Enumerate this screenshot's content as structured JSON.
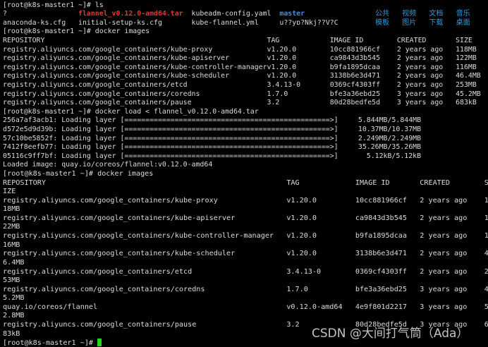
{
  "colors": {
    "background": "#000000",
    "text": "#dcdcdc",
    "archive": "#e8352f",
    "directory": "#3c8ff0",
    "cjk_dir": "#2f9ad8",
    "cursor": "#21d821"
  },
  "ls": {
    "prompt": "[root@k8s-master1 ~]# ls",
    "rows": [
      [
        {
          "t": "?"
        },
        {
          "t": "flannel_v0.12.0-amd64.tar",
          "k": "red"
        },
        {
          "t": "kubeadm-config.yaml"
        },
        {
          "t": "master",
          "k": "blue"
        },
        {
          "t": "公共",
          "k": "cjk"
        },
        {
          "t": "视频",
          "k": "cjk"
        },
        {
          "t": "文档",
          "k": "cjk"
        },
        {
          "t": "音乐",
          "k": "cjk"
        }
      ],
      [
        {
          "t": "anaconda-ks.cfg"
        },
        {
          "t": "initial-setup-ks.cfg"
        },
        {
          "t": "kube-flannel.yml"
        },
        {
          "t": "u??yɒ?Nkj??V?C"
        },
        {
          "t": "模板",
          "k": "cjk"
        },
        {
          "t": "图片",
          "k": "cjk"
        },
        {
          "t": "下载",
          "k": "cjk"
        },
        {
          "t": "桌面",
          "k": "cjk"
        }
      ]
    ]
  },
  "images1": {
    "prompt": "[root@k8s-master1 ~]# docker images",
    "header": [
      "REPOSITORY",
      "TAG",
      "IMAGE ID",
      "CREATED",
      "SIZE"
    ],
    "rows": [
      [
        "registry.aliyuncs.com/google_containers/kube-proxy",
        "v1.20.0",
        "10cc881966cf",
        "2 years ago",
        "118MB"
      ],
      [
        "registry.aliyuncs.com/google_containers/kube-apiserver",
        "v1.20.0",
        "ca9843d3b545",
        "2 years ago",
        "122MB"
      ],
      [
        "registry.aliyuncs.com/google_containers/kube-controller-manager",
        "v1.20.0",
        "b9fa1895dcaa",
        "2 years ago",
        "116MB"
      ],
      [
        "registry.aliyuncs.com/google_containers/kube-scheduler",
        "v1.20.0",
        "3138b6e3d471",
        "2 years ago",
        "46.4MB"
      ],
      [
        "registry.aliyuncs.com/google_containers/etcd",
        "3.4.13-0",
        "0369cf4303ff",
        "2 years ago",
        "253MB"
      ],
      [
        "registry.aliyuncs.com/google_containers/coredns",
        "1.7.0",
        "bfe3a36ebd25",
        "3 years ago",
        "45.2MB"
      ],
      [
        "registry.aliyuncs.com/google_containers/pause",
        "3.2",
        "80d28bedfe5d",
        "3 years ago",
        "683kB"
      ]
    ]
  },
  "load": {
    "prompt": "[root@k8s-master1 ~]# docker load < flannel_v0.12.0-amd64.tar",
    "layers": [
      {
        "id": "256a7af3acb1: Loading layer",
        "progress": 1.0,
        "size": "5.844MB/5.844MB"
      },
      {
        "id": "d572e5d9d39b: Loading layer",
        "progress": 1.0,
        "size": "10.37MB/10.37MB"
      },
      {
        "id": "57c10be5852f: Loading layer",
        "progress": 1.0,
        "size": "2.249MB/2.249MB"
      },
      {
        "id": "7412f8eefb77: Loading layer",
        "progress": 1.0,
        "size": "35.26MB/35.26MB"
      },
      {
        "id": "05116c9ff7bf: Loading layer",
        "progress": 1.0,
        "size": "5.12kB/5.12kB"
      }
    ],
    "loaded": "Loaded image: quay.io/coreos/flannel:v0.12.0-amd64"
  },
  "images2": {
    "prompt": "[root@k8s-master1 ~]# docker images",
    "header": [
      "REPOSITORY",
      "TAG",
      "IMAGE ID",
      "CREATED",
      "SIZE"
    ],
    "rows": [
      [
        "registry.aliyuncs.com/google_containers/kube-proxy",
        "v1.20.0",
        "10cc881966cf",
        "2 years ago",
        "118MB"
      ],
      [
        "registry.aliyuncs.com/google_containers/kube-apiserver",
        "v1.20.0",
        "ca9843d3b545",
        "2 years ago",
        "122MB"
      ],
      [
        "registry.aliyuncs.com/google_containers/kube-controller-manager",
        "v1.20.0",
        "b9fa1895dcaa",
        "2 years ago",
        "116MB"
      ],
      [
        "registry.aliyuncs.com/google_containers/kube-scheduler",
        "v1.20.0",
        "3138b6e3d471",
        "2 years ago",
        "46.4MB"
      ],
      [
        "registry.aliyuncs.com/google_containers/etcd",
        "3.4.13-0",
        "0369cf4303ff",
        "2 years ago",
        "253MB"
      ],
      [
        "registry.aliyuncs.com/google_containers/coredns",
        "1.7.0",
        "bfe3a36ebd25",
        "3 years ago",
        "45.2MB"
      ],
      [
        "quay.io/coreos/flannel",
        "v0.12.0-amd64",
        "4e9f801d2217",
        "3 years ago",
        "52.8MB"
      ],
      [
        "registry.aliyuncs.com/google_containers/pause",
        "3.2",
        "80d28bedfe5d",
        "3 years ago",
        "683kB"
      ]
    ]
  },
  "final_prompt": "[root@k8s-master1 ~]# ",
  "watermark": "CSDN @大间打气筒（Ada）"
}
